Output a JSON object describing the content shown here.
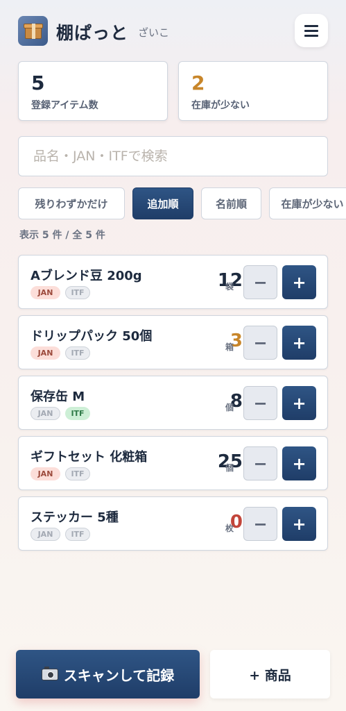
{
  "app": {
    "icon": "package-icon",
    "title": "棚ぱっと",
    "subtitle": "ざいこ",
    "menu_icon": "hamburger-icon"
  },
  "stats": [
    {
      "value": "5",
      "label": "登録アイテム数",
      "color": "#1d2a3e"
    },
    {
      "value": "2",
      "label": "在庫が少ない",
      "color": "#c8862a"
    }
  ],
  "search": {
    "placeholder": "品名・JAN・ITFで検索"
  },
  "filters": [
    {
      "label": "残りわずかだけ",
      "active": false
    },
    {
      "label": "追加順",
      "active": true
    },
    {
      "label": "名前順",
      "active": false
    },
    {
      "label": "在庫が少ない",
      "active": false
    }
  ],
  "count_text": "表示 5 件 / 全 5 件",
  "items": [
    {
      "name": "Aブレンド豆 200g",
      "qty": "12",
      "unit": "袋",
      "qty_color": "#1d2a3e",
      "jan": "JAN",
      "itf": "ITF",
      "jan_state": "on",
      "itf_state": "off"
    },
    {
      "name": "ドリップパック 50個",
      "qty": "3",
      "unit": "箱",
      "qty_color": "#c8862a",
      "jan": "JAN",
      "itf": "ITF",
      "jan_state": "on",
      "itf_state": "off"
    },
    {
      "name": "保存缶 M",
      "qty": "8",
      "unit": "個",
      "qty_color": "#1d2a3e",
      "jan": "JAN",
      "itf": "ITF",
      "jan_state": "off",
      "itf_state": "on"
    },
    {
      "name": "ギフトセット 化粧箱",
      "qty": "25",
      "unit": "個",
      "qty_color": "#1d2a3e",
      "jan": "JAN",
      "itf": "ITF",
      "jan_state": "on",
      "itf_state": "off"
    },
    {
      "name": "ステッカー 5種",
      "qty": "0",
      "unit": "枚",
      "qty_color": "#c2453a",
      "jan": "JAN",
      "itf": "ITF",
      "jan_state": "off",
      "itf_state": "off"
    }
  ],
  "controls": {
    "minus": "−",
    "plus": "+"
  },
  "bottom": {
    "scan_label": "スキャンして記録",
    "scan_icon": "camera-icon",
    "add_label": "+ 商品"
  }
}
